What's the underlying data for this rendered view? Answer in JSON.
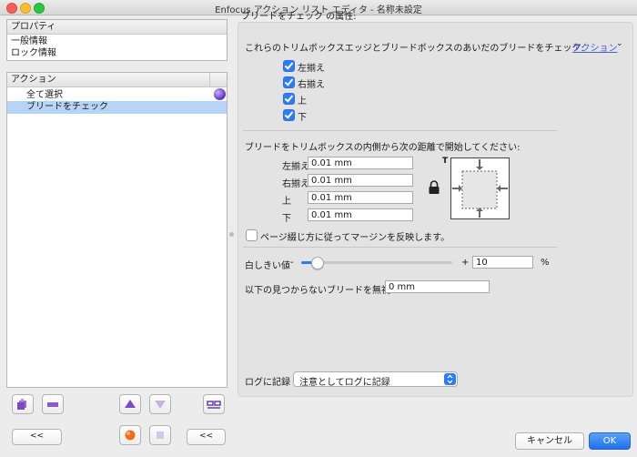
{
  "window": {
    "title": "Enfocus アクション リスト エディタ - 名称未設定"
  },
  "properties_panel": {
    "header": "プロパティ",
    "items": [
      "一般情報",
      "ロック情報"
    ]
  },
  "actions_panel": {
    "header": "アクション",
    "items": [
      {
        "label": "全て選択",
        "selected": false
      },
      {
        "label": "ブリードをチェック",
        "selected": true
      }
    ]
  },
  "left_toolbar": {
    "collapse_label": "<<",
    "collapse_label_2": "<<"
  },
  "right": {
    "attributes_title": "ブリードをチェック の属性:",
    "edges_label": "これらのトリムボックスエッジとブリードボックスのあいだのブリードをチェック:",
    "action_link": "アクション",
    "edges": [
      {
        "label": "左揃え",
        "checked": true
      },
      {
        "label": "右揃え",
        "checked": true
      },
      {
        "label": "上",
        "checked": true
      },
      {
        "label": "下",
        "checked": true
      }
    ],
    "distance_label": "ブリードをトリムボックスの内側から次の距離で開始してください:",
    "distances": [
      {
        "label": "左揃え",
        "value": "0.01 mm"
      },
      {
        "label": "右揃え",
        "value": "0.01 mm"
      },
      {
        "label": "上",
        "value": "0.01 mm"
      },
      {
        "label": "下",
        "value": "0.01 mm"
      }
    ],
    "diagram_label": "T",
    "mirror_label": "ページ綴じ方に従ってマージンを反映します。",
    "mirror_checked": false,
    "threshold_label": "白しきい値",
    "threshold_minus": "-",
    "threshold_plus": "+",
    "threshold_value": "10",
    "threshold_unit": "%",
    "threshold_slider_fraction": 0.1,
    "ignore_label": "以下の見つからないブリードを無視",
    "ignore_value": "0 mm",
    "log_label": "ログに記録",
    "log_value": "注意としてログに記録"
  },
  "footer": {
    "cancel_label": "キャンセル",
    "ok_label": "OK"
  },
  "colors": {
    "accent": "#2e7bf6",
    "selection": "#b5d4f6",
    "link": "#4a5bd6"
  }
}
